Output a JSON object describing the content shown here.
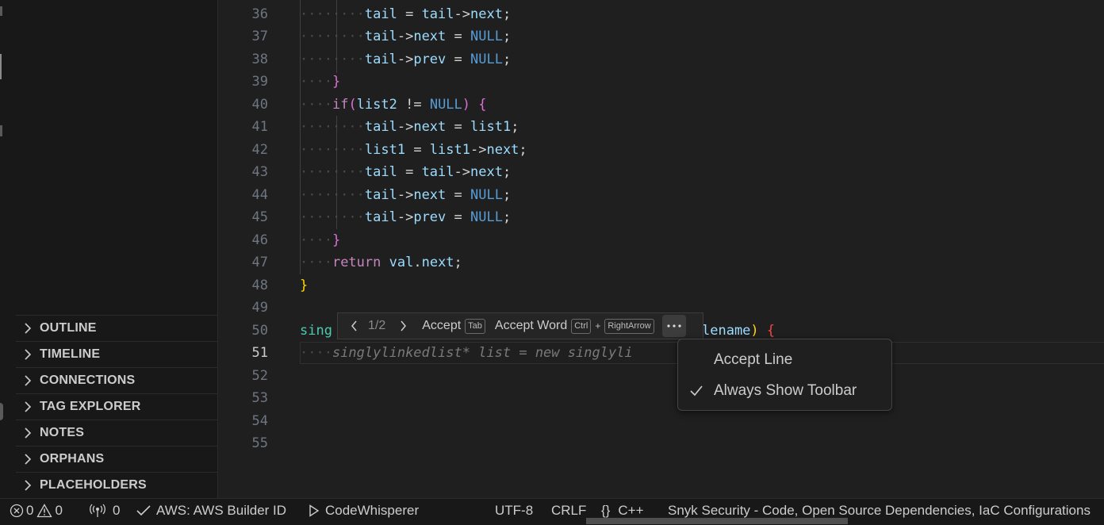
{
  "sidebar": {
    "sections": [
      {
        "label": "OUTLINE"
      },
      {
        "label": "TIMELINE"
      },
      {
        "label": "CONNECTIONS"
      },
      {
        "label": "TAG EXPLORER"
      },
      {
        "label": "NOTES"
      },
      {
        "label": "ORPHANS"
      },
      {
        "label": "PLACEHOLDERS"
      }
    ]
  },
  "editor": {
    "line_numbers": [
      "36",
      "37",
      "38",
      "39",
      "40",
      "41",
      "42",
      "43",
      "44",
      "45",
      "46",
      "47",
      "48",
      "49",
      "50",
      "51",
      "52",
      "53",
      "54",
      "55"
    ],
    "active_line": "51",
    "lines": [
      {
        "indent": 2,
        "code": "tail = tail->next;"
      },
      {
        "indent": 2,
        "code": "tail->next = NULL;"
      },
      {
        "indent": 2,
        "code": "tail->prev = NULL;"
      },
      {
        "indent": 1,
        "code": "}"
      },
      {
        "indent": 1,
        "code": "if(list2 != NULL) {"
      },
      {
        "indent": 2,
        "code": "tail->next = list1;"
      },
      {
        "indent": 2,
        "code": "list1 = list1->next;"
      },
      {
        "indent": 2,
        "code": "tail = tail->next;"
      },
      {
        "indent": 2,
        "code": "tail->next = NULL;"
      },
      {
        "indent": 2,
        "code": "tail->prev = NULL;"
      },
      {
        "indent": 1,
        "code": "}"
      },
      {
        "indent": 1,
        "code": "return val.next;"
      },
      {
        "indent": 0,
        "code": "}"
      },
      {
        "indent": 0,
        "code": ""
      },
      {
        "indent": 0,
        "code": "sing"
      },
      {
        "indent": 1,
        "code": "singlylinkedlist* list = new singlyli"
      }
    ],
    "line50_tail": "lename) {",
    "ghost_suggestion": "singlylinkedlist* list = new singlyli"
  },
  "toolbar": {
    "prev_icon": "chevron-left-icon",
    "counter": "1/2",
    "next_icon": "chevron-right-icon",
    "accept_label": "Accept",
    "accept_key": "Tab",
    "accept_word_label": "Accept Word",
    "accept_word_key1": "Ctrl",
    "plus": "+",
    "accept_word_key2": "RightArrow",
    "more_icon": "ellipsis-icon"
  },
  "menu": {
    "items": [
      {
        "label": "Accept Line",
        "checked": false
      },
      {
        "label": "Always Show Toolbar",
        "checked": true
      }
    ]
  },
  "status": {
    "errors": "0",
    "warnings": "0",
    "ports": "0",
    "aws": "AWS: AWS Builder ID",
    "codewhisperer": "CodeWhisperer",
    "encoding": "UTF-8",
    "eol": "CRLF",
    "language_icon": "{}",
    "language": "C++",
    "snyk": "Snyk Security - Code, Open Source Dependencies, IaC Configurations"
  },
  "colors": {
    "background": "#1f1f1f",
    "keyword": "#c586c0",
    "null": "#569cd6",
    "identifier": "#9cdcfe",
    "bracket_gold": "#ffd700"
  }
}
